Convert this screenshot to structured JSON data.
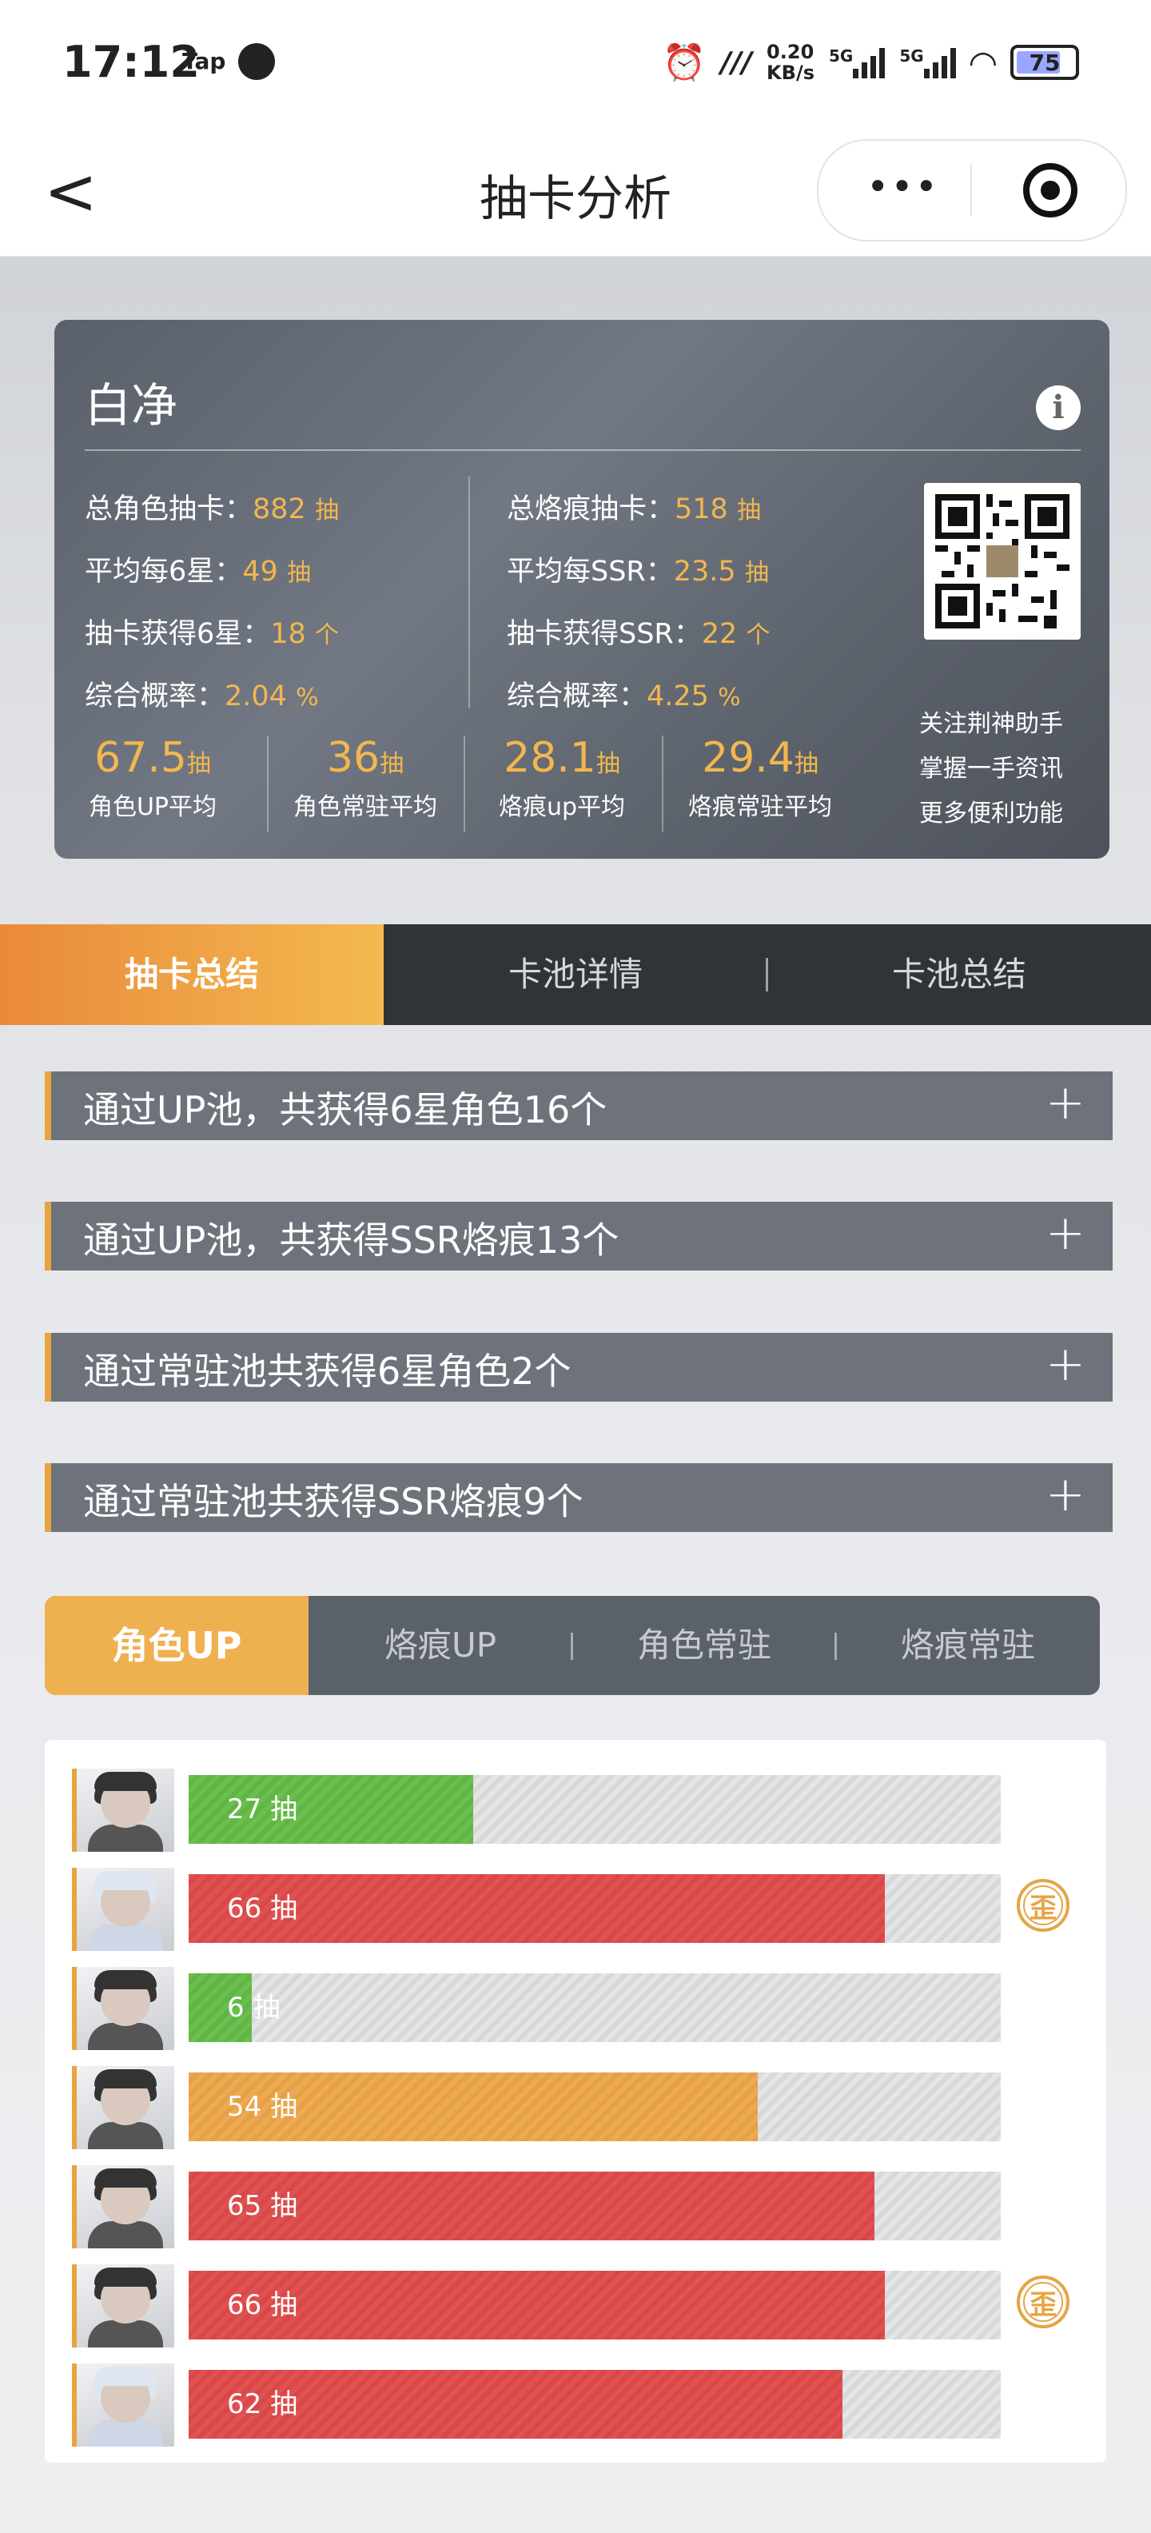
{
  "status_bar": {
    "time": "17:12",
    "tap": "Tap",
    "speed_value": "0.20",
    "speed_unit": "KB/s",
    "net1": "5G",
    "net2": "5G",
    "battery": "75"
  },
  "nav": {
    "back": "<",
    "title": "抽卡分析",
    "more": "•••"
  },
  "profile": {
    "name": "白净",
    "info_icon": "i",
    "left": [
      {
        "label": "总角色抽卡：",
        "value": "882",
        "unit": "抽"
      },
      {
        "label": "平均每6星：",
        "value": "49",
        "unit": "抽"
      },
      {
        "label": "抽卡获得6星：",
        "value": "18",
        "unit": "个"
      },
      {
        "label": "综合概率：",
        "value": "2.04",
        "unit": "%"
      }
    ],
    "right": [
      {
        "label": "总烙痕抽卡：",
        "value": "518",
        "unit": "抽"
      },
      {
        "label": "平均每SSR：",
        "value": "23.5",
        "unit": "抽"
      },
      {
        "label": "抽卡获得SSR：",
        "value": "22",
        "unit": "个"
      },
      {
        "label": "综合概率：",
        "value": "4.25",
        "unit": "%"
      }
    ],
    "averages": [
      {
        "value": "67.5",
        "unit": "抽",
        "label": "角色UP平均"
      },
      {
        "value": "36",
        "unit": "抽",
        "label": "角色常驻平均"
      },
      {
        "value": "28.1",
        "unit": "抽",
        "label": "烙痕up平均"
      },
      {
        "value": "29.4",
        "unit": "抽",
        "label": "烙痕常驻平均"
      }
    ],
    "promo": [
      "关注荆神助手",
      "掌握一手资讯",
      "更多便利功能"
    ]
  },
  "main_tabs": [
    "抽卡总结",
    "卡池详情",
    "卡池总结"
  ],
  "summaries": [
    "通过UP池，共获得6星角色16个",
    "通过UP池，共获得SSR烙痕13个",
    "通过常驻池共获得6星角色2个",
    "通过常驻池共获得SSR烙痕9个"
  ],
  "expand_symbol": "+",
  "pool_tabs": [
    "角色UP",
    "烙痕UP",
    "角色常驻",
    "烙痕常驻"
  ],
  "wai_label": "歪",
  "pulls": [
    {
      "label": "27 抽",
      "fraction": 0.35,
      "color": "green",
      "wai": false,
      "avatar": "dark"
    },
    {
      "label": "66 抽",
      "fraction": 0.857,
      "color": "red",
      "wai": true,
      "avatar": "light"
    },
    {
      "label": "6 抽",
      "fraction": 0.078,
      "color": "green",
      "wai": false,
      "avatar": "dark"
    },
    {
      "label": "54 抽",
      "fraction": 0.701,
      "color": "orange",
      "wai": false,
      "avatar": "dark"
    },
    {
      "label": "65 抽",
      "fraction": 0.844,
      "color": "red",
      "wai": false,
      "avatar": "dark"
    },
    {
      "label": "66 抽",
      "fraction": 0.857,
      "color": "red",
      "wai": true,
      "avatar": "dark"
    },
    {
      "label": "62 抽",
      "fraction": 0.805,
      "color": "red",
      "wai": false,
      "avatar": "light"
    }
  ]
}
